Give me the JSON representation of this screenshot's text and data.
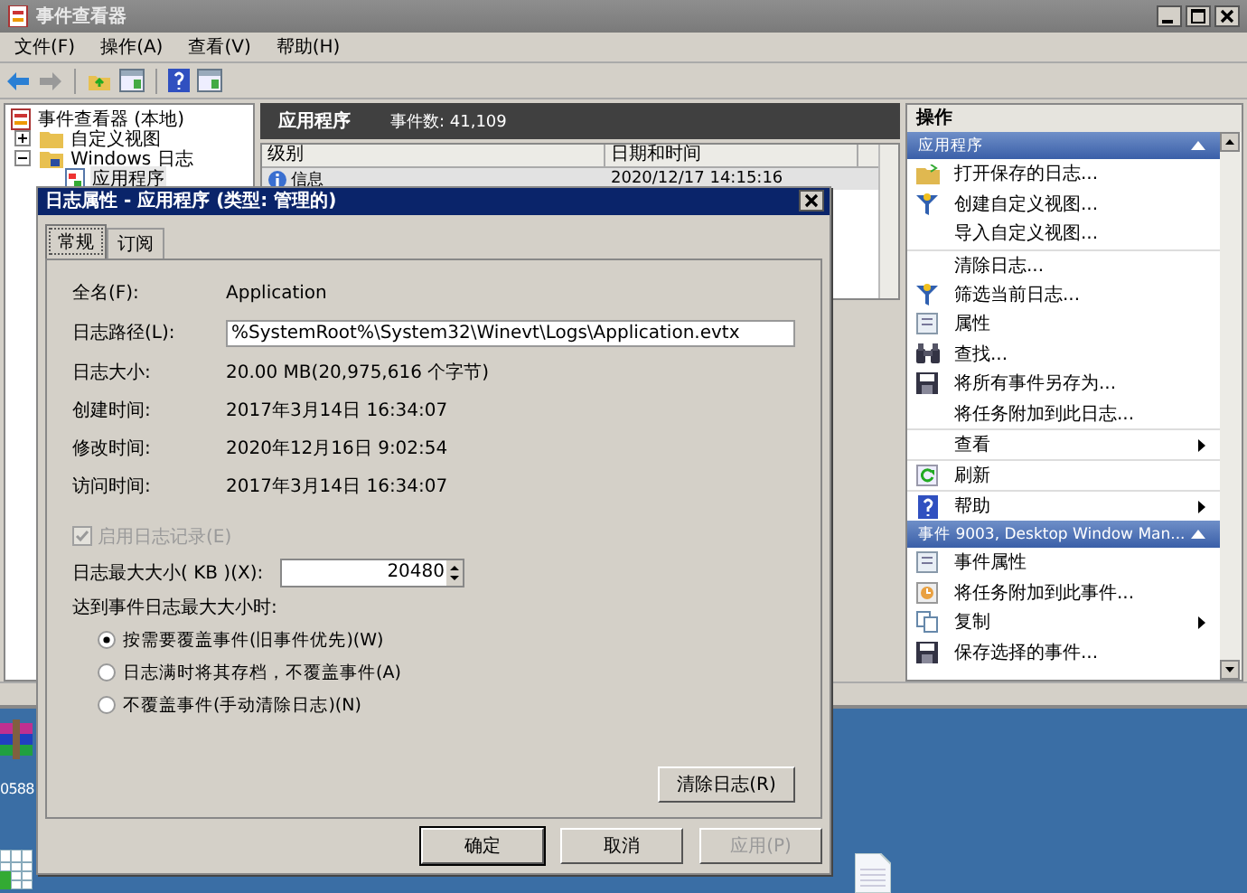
{
  "window": {
    "title": "事件查看器"
  },
  "menu": [
    {
      "label": "文件(F)"
    },
    {
      "label": "操作(A)"
    },
    {
      "label": "查看(V)"
    },
    {
      "label": "帮助(H)"
    }
  ],
  "tree": {
    "root": "事件查看器 (本地)",
    "children": [
      {
        "label": "自定义视图",
        "expanded": false
      },
      {
        "label": "Windows 日志",
        "expanded": true,
        "children": [
          {
            "label": "应用程序",
            "selected": true
          }
        ]
      }
    ]
  },
  "log_header": {
    "title": "应用程序",
    "count": "事件数: 41,109"
  },
  "events": {
    "columns": [
      "级别",
      "日期和时间"
    ],
    "rows": [
      {
        "level": "信息",
        "date": "2020/12/17 14:15:16",
        "selected": true
      }
    ]
  },
  "actions": {
    "title": "操作",
    "sections": [
      {
        "title": "应用程序",
        "expanded": true,
        "items": [
          {
            "label": "打开保存的日志...",
            "submenu": false,
            "separator_before": false
          },
          {
            "label": "创建自定义视图...",
            "submenu": false,
            "separator_before": false
          },
          {
            "label": "导入自定义视图...",
            "submenu": false,
            "separator_before": false
          },
          {
            "label": "清除日志...",
            "submenu": false,
            "separator_before": true
          },
          {
            "label": "筛选当前日志...",
            "submenu": false,
            "separator_before": false
          },
          {
            "label": "属性",
            "submenu": false,
            "separator_before": false
          },
          {
            "label": "查找...",
            "submenu": false,
            "separator_before": false
          },
          {
            "label": "将所有事件另存为...",
            "submenu": false,
            "separator_before": false
          },
          {
            "label": "将任务附加到此日志...",
            "submenu": false,
            "separator_before": false
          },
          {
            "label": "查看",
            "submenu": true,
            "separator_before": true
          },
          {
            "label": "刷新",
            "submenu": false,
            "separator_before": true
          },
          {
            "label": "帮助",
            "submenu": true,
            "separator_before": true
          }
        ]
      },
      {
        "title": "事件 9003, Desktop Window Man...",
        "expanded": true,
        "items": [
          {
            "label": "事件属性",
            "submenu": false,
            "separator_before": false
          },
          {
            "label": "将任务附加到此事件...",
            "submenu": false,
            "separator_before": false
          },
          {
            "label": "复制",
            "submenu": true,
            "separator_before": false
          },
          {
            "label": "保存选择的事件...",
            "submenu": false,
            "separator_before": false
          }
        ]
      }
    ]
  },
  "desktop": {
    "icon_label": "0588"
  },
  "dialog": {
    "title": "日志属性 - 应用程序 (类型: 管理的)",
    "tabs": [
      {
        "label": "常规",
        "selected": true
      },
      {
        "label": "订阅",
        "selected": false
      }
    ],
    "fields": [
      {
        "kind": "text",
        "label": "全名(F):",
        "value": "Application"
      },
      {
        "kind": "input",
        "label": "日志路径(L):",
        "value": "%SystemRoot%\\System32\\Winevt\\Logs\\Application.evtx"
      },
      {
        "kind": "text",
        "label": "日志大小:",
        "value": "20.00 MB(20,975,616 个字节)"
      },
      {
        "kind": "text",
        "label": "创建时间:",
        "value": "2017年3月14日 16:34:07"
      },
      {
        "kind": "text",
        "label": "修改时间:",
        "value": "2020年12月16日 9:02:54"
      },
      {
        "kind": "text",
        "label": "访问时间:",
        "value": "2017年3月14日 16:34:07"
      }
    ],
    "enable_logging": {
      "label": "启用日志记录(E)",
      "checked": true,
      "disabled": true
    },
    "max_size": {
      "label": "日志最大大小( KB )(X):",
      "value": "20480"
    },
    "policy_label": "达到事件日志最大大小时:",
    "policies": [
      {
        "label": "按需要覆盖事件(旧事件优先)(W)",
        "selected": true
      },
      {
        "label": "日志满时将其存档，不覆盖事件(A)",
        "selected": false
      },
      {
        "label": "不覆盖事件(手动清除日志)(N)",
        "selected": false
      }
    ],
    "clear_button": "清除日志(R)",
    "buttons": [
      {
        "label": "确定",
        "disabled": false,
        "default": true
      },
      {
        "label": "取消",
        "disabled": false,
        "default": false
      },
      {
        "label": "应用(P)",
        "disabled": true,
        "default": false
      }
    ]
  }
}
